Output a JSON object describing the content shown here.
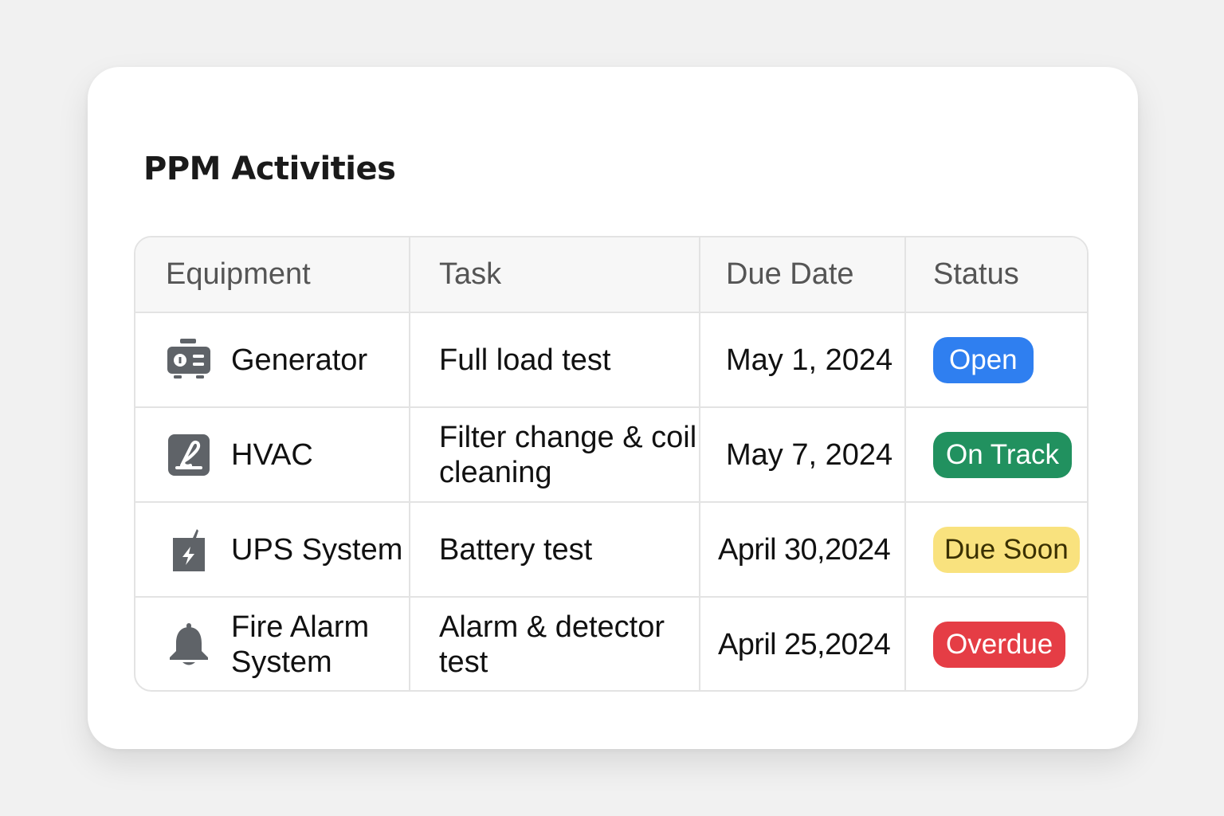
{
  "title": "PPM Activities",
  "columns": {
    "equipment": "Equipment",
    "task": "Task",
    "due_date": "Due Date",
    "status": "Status"
  },
  "rows": [
    {
      "equipment": "Generator",
      "icon": "generator-icon",
      "task": "Full load test",
      "due_date": "May 1, 2024",
      "status": "Open",
      "status_color": "#2f7ff0"
    },
    {
      "equipment": "HVAC",
      "icon": "hvac-icon",
      "task": "Filter change & coil cleaning",
      "due_date": "May 7, 2024",
      "status": "On Track",
      "status_color": "#21915f"
    },
    {
      "equipment": "UPS System",
      "icon": "battery-bolt-icon",
      "task": "Battery test",
      "due_date": "April 30,2024",
      "status": "Due Soon",
      "status_color": "#f9e27e"
    },
    {
      "equipment": "Fire Alarm System",
      "icon": "bell-icon",
      "task": "Alarm & detector test",
      "due_date": "April 25,2024",
      "status": "Overdue",
      "status_color": "#e53d45"
    }
  ],
  "colors": {
    "icon": "#5f6368",
    "border": "#e3e3e3",
    "header_bg": "#f7f7f7"
  }
}
